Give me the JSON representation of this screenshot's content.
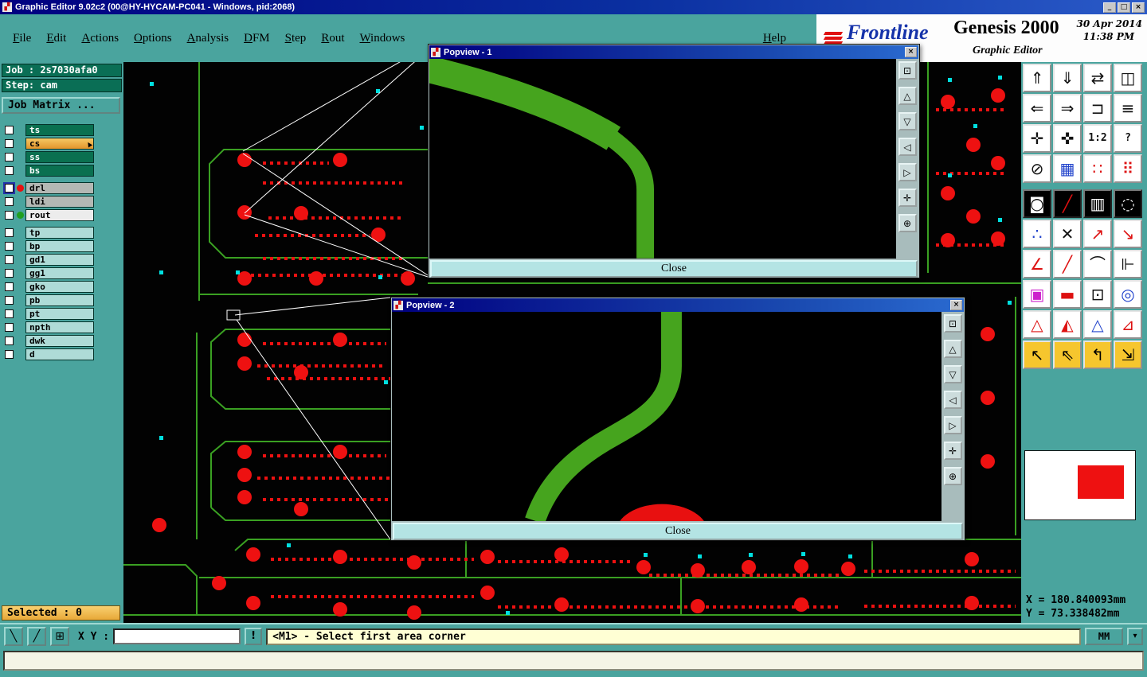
{
  "window": {
    "title": "Graphic Editor 9.02c2 (00@HY-HYCAM-PC041 - Windows, pid:2068)",
    "icon": "▞",
    "min": "_",
    "max": "□",
    "close": "×"
  },
  "brand": {
    "logo_text": "Frontline",
    "product": "Genesis 2000",
    "date": "30 Apr 2014",
    "time": "11:38 PM",
    "subtitle": "Graphic Editor"
  },
  "menu": {
    "items": [
      "File",
      "Edit",
      "Actions",
      "Options",
      "Analysis",
      "DFM",
      "Step",
      "Rout",
      "Windows"
    ],
    "help": "Help"
  },
  "sidebar": {
    "job_label": "Job : 2s7030afa0",
    "step_label": "Step: cam",
    "job_matrix_button": "Job Matrix ...",
    "selected_label": "Selected : 0",
    "layers": [
      {
        "name": "ts",
        "type": "dark"
      },
      {
        "name": "cs",
        "type": "active",
        "cursor": true
      },
      {
        "name": "ss",
        "type": "dark"
      },
      {
        "name": "bs",
        "type": "dark"
      },
      {
        "name": "drl",
        "type": "gray",
        "dot": "red",
        "check_bg": "navy",
        "gap_before": true
      },
      {
        "name": "ldi",
        "type": "gray"
      },
      {
        "name": "rout",
        "type": "light",
        "dot": "green"
      },
      {
        "name": "tp",
        "type": "cyan",
        "gap_before": true
      },
      {
        "name": "bp",
        "type": "cyan"
      },
      {
        "name": "gd1",
        "type": "cyan"
      },
      {
        "name": "gg1",
        "type": "cyan"
      },
      {
        "name": "gko",
        "type": "cyan"
      },
      {
        "name": "pb",
        "type": "cyan"
      },
      {
        "name": "pt",
        "type": "cyan"
      },
      {
        "name": "npth",
        "type": "cyan"
      },
      {
        "name": "dwk",
        "type": "cyan"
      },
      {
        "name": "d",
        "type": "cyan"
      }
    ]
  },
  "popviews": [
    {
      "title": "Popview - 1",
      "close_x": "×",
      "close": "Close"
    },
    {
      "title": "Popview - 2",
      "close_x": "×",
      "close": "Close"
    }
  ],
  "popview_tools": [
    {
      "name": "zoom-window-icon",
      "glyph": "⊡"
    },
    {
      "name": "pan-up-icon",
      "glyph": "△"
    },
    {
      "name": "pan-down-icon",
      "glyph": "▽"
    },
    {
      "name": "pan-left-icon",
      "glyph": "◁"
    },
    {
      "name": "pan-right-icon",
      "glyph": "▷"
    },
    {
      "name": "fit-view-icon",
      "glyph": "✛"
    },
    {
      "name": "zoom-full-icon",
      "glyph": "⊕"
    }
  ],
  "right_toolbar": {
    "buttons": [
      {
        "name": "pan-view-up-icon",
        "glyph": "⇑",
        "style": ""
      },
      {
        "name": "pan-view-down-icon",
        "glyph": "⇓",
        "style": ""
      },
      {
        "name": "swap-views-icon",
        "glyph": "⇄",
        "style": ""
      },
      {
        "name": "split-view-icon",
        "glyph": "◫",
        "style": ""
      },
      {
        "name": "pan-view-left-icon",
        "glyph": "⇐",
        "style": ""
      },
      {
        "name": "pan-view-right-icon",
        "glyph": "⇒",
        "style": ""
      },
      {
        "name": "clip-view-icon",
        "glyph": "⊐",
        "style": ""
      },
      {
        "name": "stack-layers-icon",
        "glyph": "≡",
        "style": ""
      },
      {
        "name": "zoom-extents-icon",
        "glyph": "✛",
        "style": ""
      },
      {
        "name": "move-view-icon",
        "glyph": "✜",
        "style": ""
      },
      {
        "name": "scale-1-2-button",
        "glyph": "1:2",
        "style": "txt"
      },
      {
        "name": "help-icon",
        "glyph": "?",
        "style": "txt"
      },
      {
        "name": "measure-icon",
        "glyph": "⊘",
        "style": ""
      },
      {
        "name": "grid-icon",
        "glyph": "▦",
        "style": "blue"
      },
      {
        "name": "snap-points-icon",
        "glyph": "∷",
        "style": "red"
      },
      {
        "name": "dot-matrix-icon",
        "glyph": "⠿",
        "style": "red"
      },
      {
        "name": "highlight-pad-icon",
        "glyph": "◙",
        "style": "dark"
      },
      {
        "name": "slant-line-icon",
        "glyph": "╱",
        "style": "dark red"
      },
      {
        "name": "ruler-icon",
        "glyph": "▥",
        "style": "dark"
      },
      {
        "name": "dotted-circle-icon",
        "glyph": "◌",
        "style": "dark"
      },
      {
        "name": "net-points-icon",
        "glyph": "∴",
        "style": "blue"
      },
      {
        "name": "close-polygon-icon",
        "glyph": "✕",
        "style": ""
      },
      {
        "name": "vertex-arrow-icon",
        "glyph": "↗",
        "style": "red"
      },
      {
        "name": "segment-arrow-icon",
        "glyph": "↘",
        "style": "red"
      },
      {
        "name": "angle-measure-icon",
        "glyph": "∠",
        "style": "red"
      },
      {
        "name": "line-45-icon",
        "glyph": "╱",
        "style": "red"
      },
      {
        "name": "arc-tool-icon",
        "glyph": "⌒",
        "style": ""
      },
      {
        "name": "mirror-text-icon",
        "glyph": "⊩",
        "style": ""
      },
      {
        "name": "swap-frames-icon",
        "glyph": "▣",
        "style": "magenta"
      },
      {
        "name": "dash-tool-icon",
        "glyph": "▬",
        "style": "red"
      },
      {
        "name": "box-select-icon",
        "glyph": "⊡",
        "style": ""
      },
      {
        "name": "overlap-circles-icon",
        "glyph": "◎",
        "style": "blue"
      },
      {
        "name": "triangle-outline-icon",
        "glyph": "△",
        "style": "red"
      },
      {
        "name": "triangle-fill-icon",
        "glyph": "◭",
        "style": "red"
      },
      {
        "name": "triangle-blue-icon",
        "glyph": "△",
        "style": "blue"
      },
      {
        "name": "right-triangle-icon",
        "glyph": "⊿",
        "style": "red"
      },
      {
        "name": "select-arrow-icon",
        "glyph": "↖",
        "style": "yellow"
      },
      {
        "name": "select-add-icon",
        "glyph": "⇖",
        "style": "yellow"
      },
      {
        "name": "select-query-icon",
        "glyph": "↰",
        "style": "yellow"
      },
      {
        "name": "select-axes-icon",
        "glyph": "⇲",
        "style": "yellow"
      }
    ]
  },
  "coordinates": {
    "x": "X = 180.840093mm",
    "y": "Y = 73.338482mm"
  },
  "statusbar": {
    "tools": [
      {
        "name": "diagonal-line-tool-icon",
        "glyph": "╲"
      },
      {
        "name": "ortho-line-tool-icon",
        "glyph": "╱"
      },
      {
        "name": "grid-toggle-icon",
        "glyph": "⊞"
      }
    ],
    "xy_label": "X Y :",
    "input_value": "",
    "alert": "!",
    "message": "<M1> - Select first area corner",
    "units": "MM",
    "units_arrow": "▾",
    "output": ""
  }
}
